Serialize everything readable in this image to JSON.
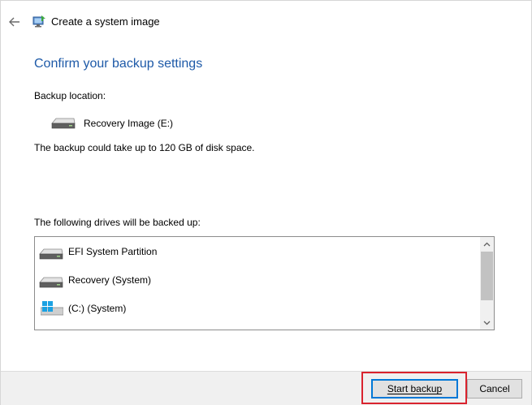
{
  "window": {
    "title": "Create a system image",
    "icons": {
      "back": "back-arrow-icon",
      "title": "system-image-backup-icon"
    }
  },
  "main": {
    "heading": "Confirm your backup settings",
    "backup_location_label": "Backup location:",
    "backup_location": {
      "icon": "hard-drive-icon",
      "name": "Recovery Image (E:)"
    },
    "space_note": "The backup could take up to 120 GB of disk space.",
    "drives_label": "The following drives will be backed up:",
    "drives": [
      {
        "icon": "hard-drive-icon",
        "name": "EFI System Partition"
      },
      {
        "icon": "hard-drive-icon",
        "name": "Recovery (System)"
      },
      {
        "icon": "windows-logo-icon",
        "name": "(C:) (System)"
      }
    ]
  },
  "footer": {
    "start_backup_label": "Start backup",
    "cancel_label": "Cancel"
  },
  "colors": {
    "heading": "#1e5aa8",
    "highlight": "#d9232e",
    "focus": "#0078d7",
    "windows_logo": "#1ba1e2"
  }
}
